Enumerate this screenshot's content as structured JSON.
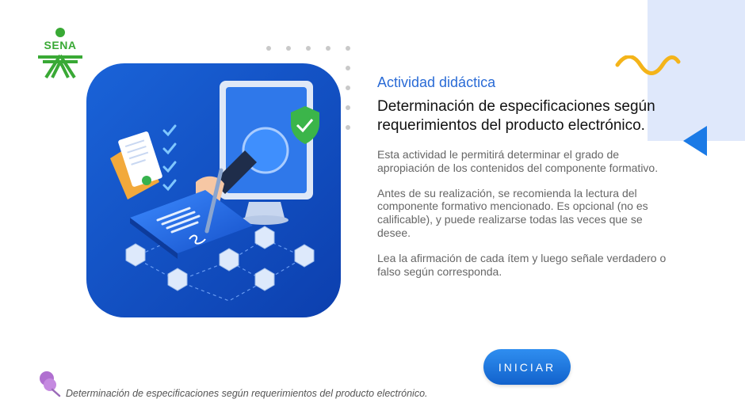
{
  "brand": {
    "logo_text": "SENA",
    "color": "#39a935"
  },
  "activity": {
    "kicker": "Actividad didáctica",
    "title": "Determinación de especificaciones según requerimientos del producto electrónico.",
    "paragraphs": [
      "Esta actividad le permitirá determinar el grado de apropiación de los contenidos del componente formativo.",
      "Antes de su realización, se recomienda la lectura del componente formativo mencionado. Es opcional (no es calificable), y puede realizarse todas las veces que se desee.",
      "Lea la afirmación de cada ítem y luego señale verdadero o falso según corresponda."
    ]
  },
  "actions": {
    "start_label": "INICIAR"
  },
  "footer": {
    "text": "Determinación de especificaciones según requerimientos del producto electrónico."
  },
  "colors": {
    "accent_blue": "#2a6bd6",
    "button_blue": "#1e78e6",
    "wave_yellow": "#f4b41a",
    "deco_bg": "#dfe8fb",
    "pin_purple": "#b06fd0"
  },
  "icons": [
    "sena-logo",
    "illustration-digital-signature",
    "wave-decoration",
    "triangle-decoration",
    "pushpin-icon"
  ]
}
